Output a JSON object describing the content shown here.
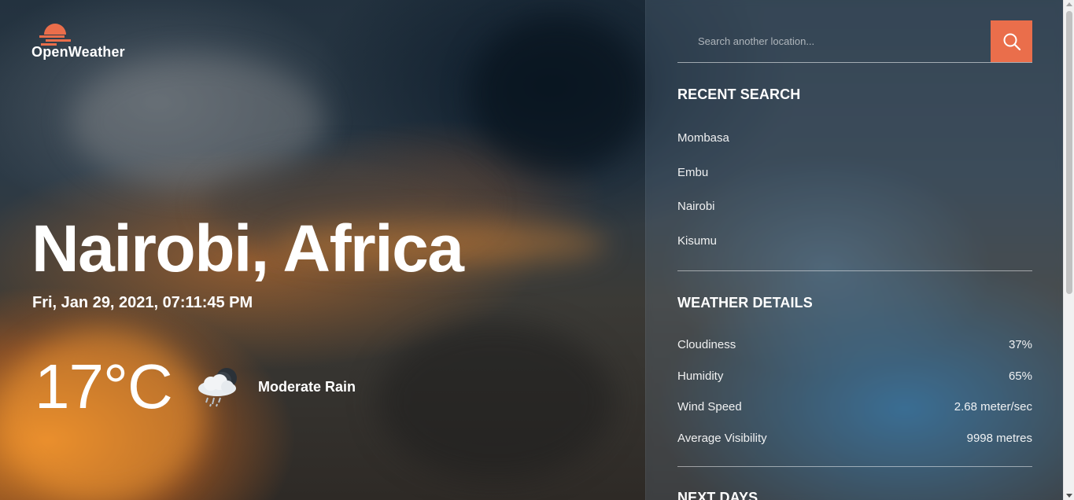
{
  "app": {
    "logo_text": "OpenWeather",
    "logo_icon": "sunset-icon"
  },
  "current": {
    "location": "Nairobi, Africa",
    "datetime": "Fri, Jan 29, 2021, 07:11:45 PM",
    "temperature": "17°C",
    "condition": "Moderate Rain",
    "condition_icon": "rain-cloud-moon-icon"
  },
  "search": {
    "placeholder": "Search another location...",
    "button_icon": "search-icon"
  },
  "recent": {
    "title": "RECENT SEARCH",
    "items": [
      "Mombasa",
      "Embu",
      "Nairobi",
      "Kisumu"
    ]
  },
  "details": {
    "title": "WEATHER DETAILS",
    "rows": [
      {
        "label": "Cloudiness",
        "value": "37%"
      },
      {
        "label": "Humidity",
        "value": "65%"
      },
      {
        "label": "Wind Speed",
        "value": "2.68 meter/sec"
      },
      {
        "label": "Average Visibility",
        "value": "9998 metres"
      }
    ]
  },
  "next_days": {
    "title": "NEXT DAYS"
  },
  "colors": {
    "accent": "#ea6e4b"
  }
}
